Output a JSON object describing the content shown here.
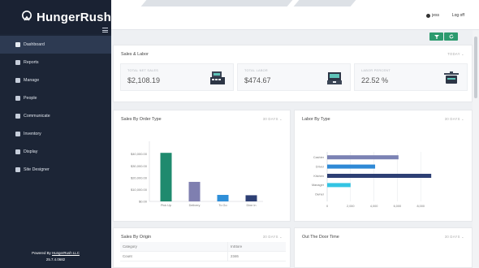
{
  "brand": {
    "name": "HungerRush"
  },
  "topbar": {
    "user": "jess",
    "logoff": "Log off"
  },
  "sidebar": {
    "items": [
      {
        "label": "Dashboard",
        "icon": "home-icon",
        "active": true
      },
      {
        "label": "Reports",
        "icon": "bar-chart-icon"
      },
      {
        "label": "Manage",
        "icon": "wrench-icon"
      },
      {
        "label": "People",
        "icon": "users-icon"
      },
      {
        "label": "Communicate",
        "icon": "chat-icon"
      },
      {
        "label": "Inventory",
        "icon": "clipboard-icon"
      },
      {
        "label": "Display",
        "icon": "truck-icon"
      },
      {
        "label": "Site Designer",
        "icon": "palette-icon"
      }
    ],
    "powered_prefix": "Powered By ",
    "powered_link": "HungerRush LLC",
    "version": "25.7.4.0682"
  },
  "toolbar": {
    "filter_icon": "filter-icon",
    "refresh_icon": "refresh-icon"
  },
  "sales_labor": {
    "title": "Sales & Labor",
    "period": "TODAY",
    "kpis": [
      {
        "label": "TOTAL NET SALES",
        "value": "$2,108.19",
        "icon": "register-icon"
      },
      {
        "label": "TOTAL LABOR",
        "value": "$474.67",
        "icon": "register-icon"
      },
      {
        "label": "LABOR PERCENT",
        "value": "22.52 %",
        "icon": "cooking-pot-icon"
      }
    ]
  },
  "sales_by_order_type": {
    "title": "Sales By Order Type",
    "period": "30 DAYS"
  },
  "labor_by_type": {
    "title": "Labor By Type",
    "period": "30 DAYS"
  },
  "sales_by_origin": {
    "title": "Sales By Origin",
    "period": "30 DAYS",
    "columns": [
      "Category",
      "InStore"
    ],
    "rows": [
      [
        "Count",
        "2346"
      ]
    ]
  },
  "out_the_door": {
    "title": "Out The Door Time",
    "period": "30 DAYS"
  },
  "chart_data": [
    {
      "type": "bar",
      "title": "Sales By Order Type",
      "categories": [
        "Pick Up",
        "Delivery",
        "To Go",
        "Dine In"
      ],
      "values": [
        41000,
        16500,
        5500,
        5200
      ],
      "colors": [
        "#1f8a6e",
        "#7f7fb0",
        "#2f8fd8",
        "#2d3f74"
      ],
      "yticks": [
        "$0.00",
        "$10,000.00",
        "$20,000.00",
        "$30,000.00",
        "$40,000.00"
      ],
      "ylim": [
        0,
        48000
      ],
      "grid": false
    },
    {
      "type": "bar",
      "orientation": "horizontal",
      "title": "Labor By Type",
      "categories": [
        "Cashier",
        "Driver",
        "Kitchen",
        "Manager",
        "Owner"
      ],
      "values": [
        6100,
        4100,
        8900,
        2000,
        0
      ],
      "colors": [
        "#7b82b4",
        "#2f89d6",
        "#2d3f74",
        "#33c4e3",
        "#9aa0ad"
      ],
      "xticks": [
        "0",
        "2,000",
        "4,000",
        "6,000",
        "8,000"
      ],
      "xlim": [
        0,
        10000
      ],
      "grid": true
    }
  ]
}
